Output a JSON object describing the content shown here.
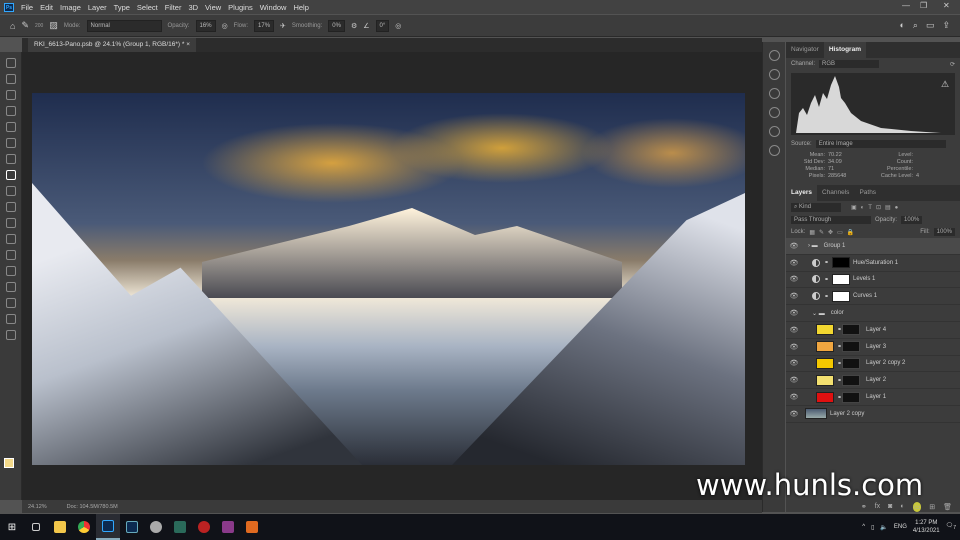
{
  "menu": [
    "File",
    "Edit",
    "Image",
    "Layer",
    "Type",
    "Select",
    "Filter",
    "3D",
    "View",
    "Plugins",
    "Window",
    "Help"
  ],
  "app_logo": "Ps",
  "options": {
    "mode_label": "Mode:",
    "mode": "Normal",
    "opacity_label": "Opacity:",
    "opacity": "16%",
    "flow_label": "Flow:",
    "flow": "17%",
    "smoothing_label": "Smoothing:",
    "smoothing": "0%",
    "angle": "0°",
    "brush_size": "200"
  },
  "document_tab": "RKI_6613-Pano.psb @ 24.1% (Group 1, RGB/16*) *",
  "histogram": {
    "tabs": [
      "Navigator",
      "Histogram"
    ],
    "channel_label": "Channel:",
    "channel": "RGB",
    "source_label": "Source:",
    "source": "Entire Image",
    "stats": [
      [
        "Mean:",
        "70.22",
        "Level:",
        ""
      ],
      [
        "Std Dev:",
        "34.09",
        "Count:",
        ""
      ],
      [
        "Median:",
        "71",
        "Percentile:",
        ""
      ],
      [
        "Pixels:",
        "285648",
        "Cache Level:",
        "4"
      ]
    ]
  },
  "layers_panel": {
    "tabs": [
      "Layers",
      "Channels",
      "Paths"
    ],
    "filter": "Kind",
    "blend": "Pass Through",
    "opacity_label": "Opacity:",
    "opacity": "100%",
    "lock_label": "Lock:",
    "fill_label": "Fill:",
    "fill": "100%",
    "layers": [
      {
        "name": "Group 1",
        "type": "group"
      },
      {
        "name": "Hue/Saturation 1",
        "type": "adj"
      },
      {
        "name": "Levels 1",
        "type": "adj"
      },
      {
        "name": "Curves 1",
        "type": "adj"
      },
      {
        "name": "color",
        "type": "group"
      },
      {
        "name": "Layer 4",
        "type": "fill",
        "color": "#f2d730"
      },
      {
        "name": "Layer 3",
        "type": "fill",
        "color": "#f0a640"
      },
      {
        "name": "Layer 2 copy 2",
        "type": "fill",
        "color": "#f5c800"
      },
      {
        "name": "Layer 2",
        "type": "fill",
        "color": "#f3e070"
      },
      {
        "name": "Layer 1",
        "type": "fill",
        "color": "#e01010"
      },
      {
        "name": "Layer 2 copy",
        "type": "image"
      }
    ]
  },
  "status": {
    "zoom": "24.12%",
    "doc": "Doc: 104.5M/780.5M"
  },
  "taskbar": {
    "time": "1:27 PM",
    "date": "4/13/2021",
    "lang": "ENG",
    "notif": "7"
  },
  "watermark": "www.hunls.com"
}
